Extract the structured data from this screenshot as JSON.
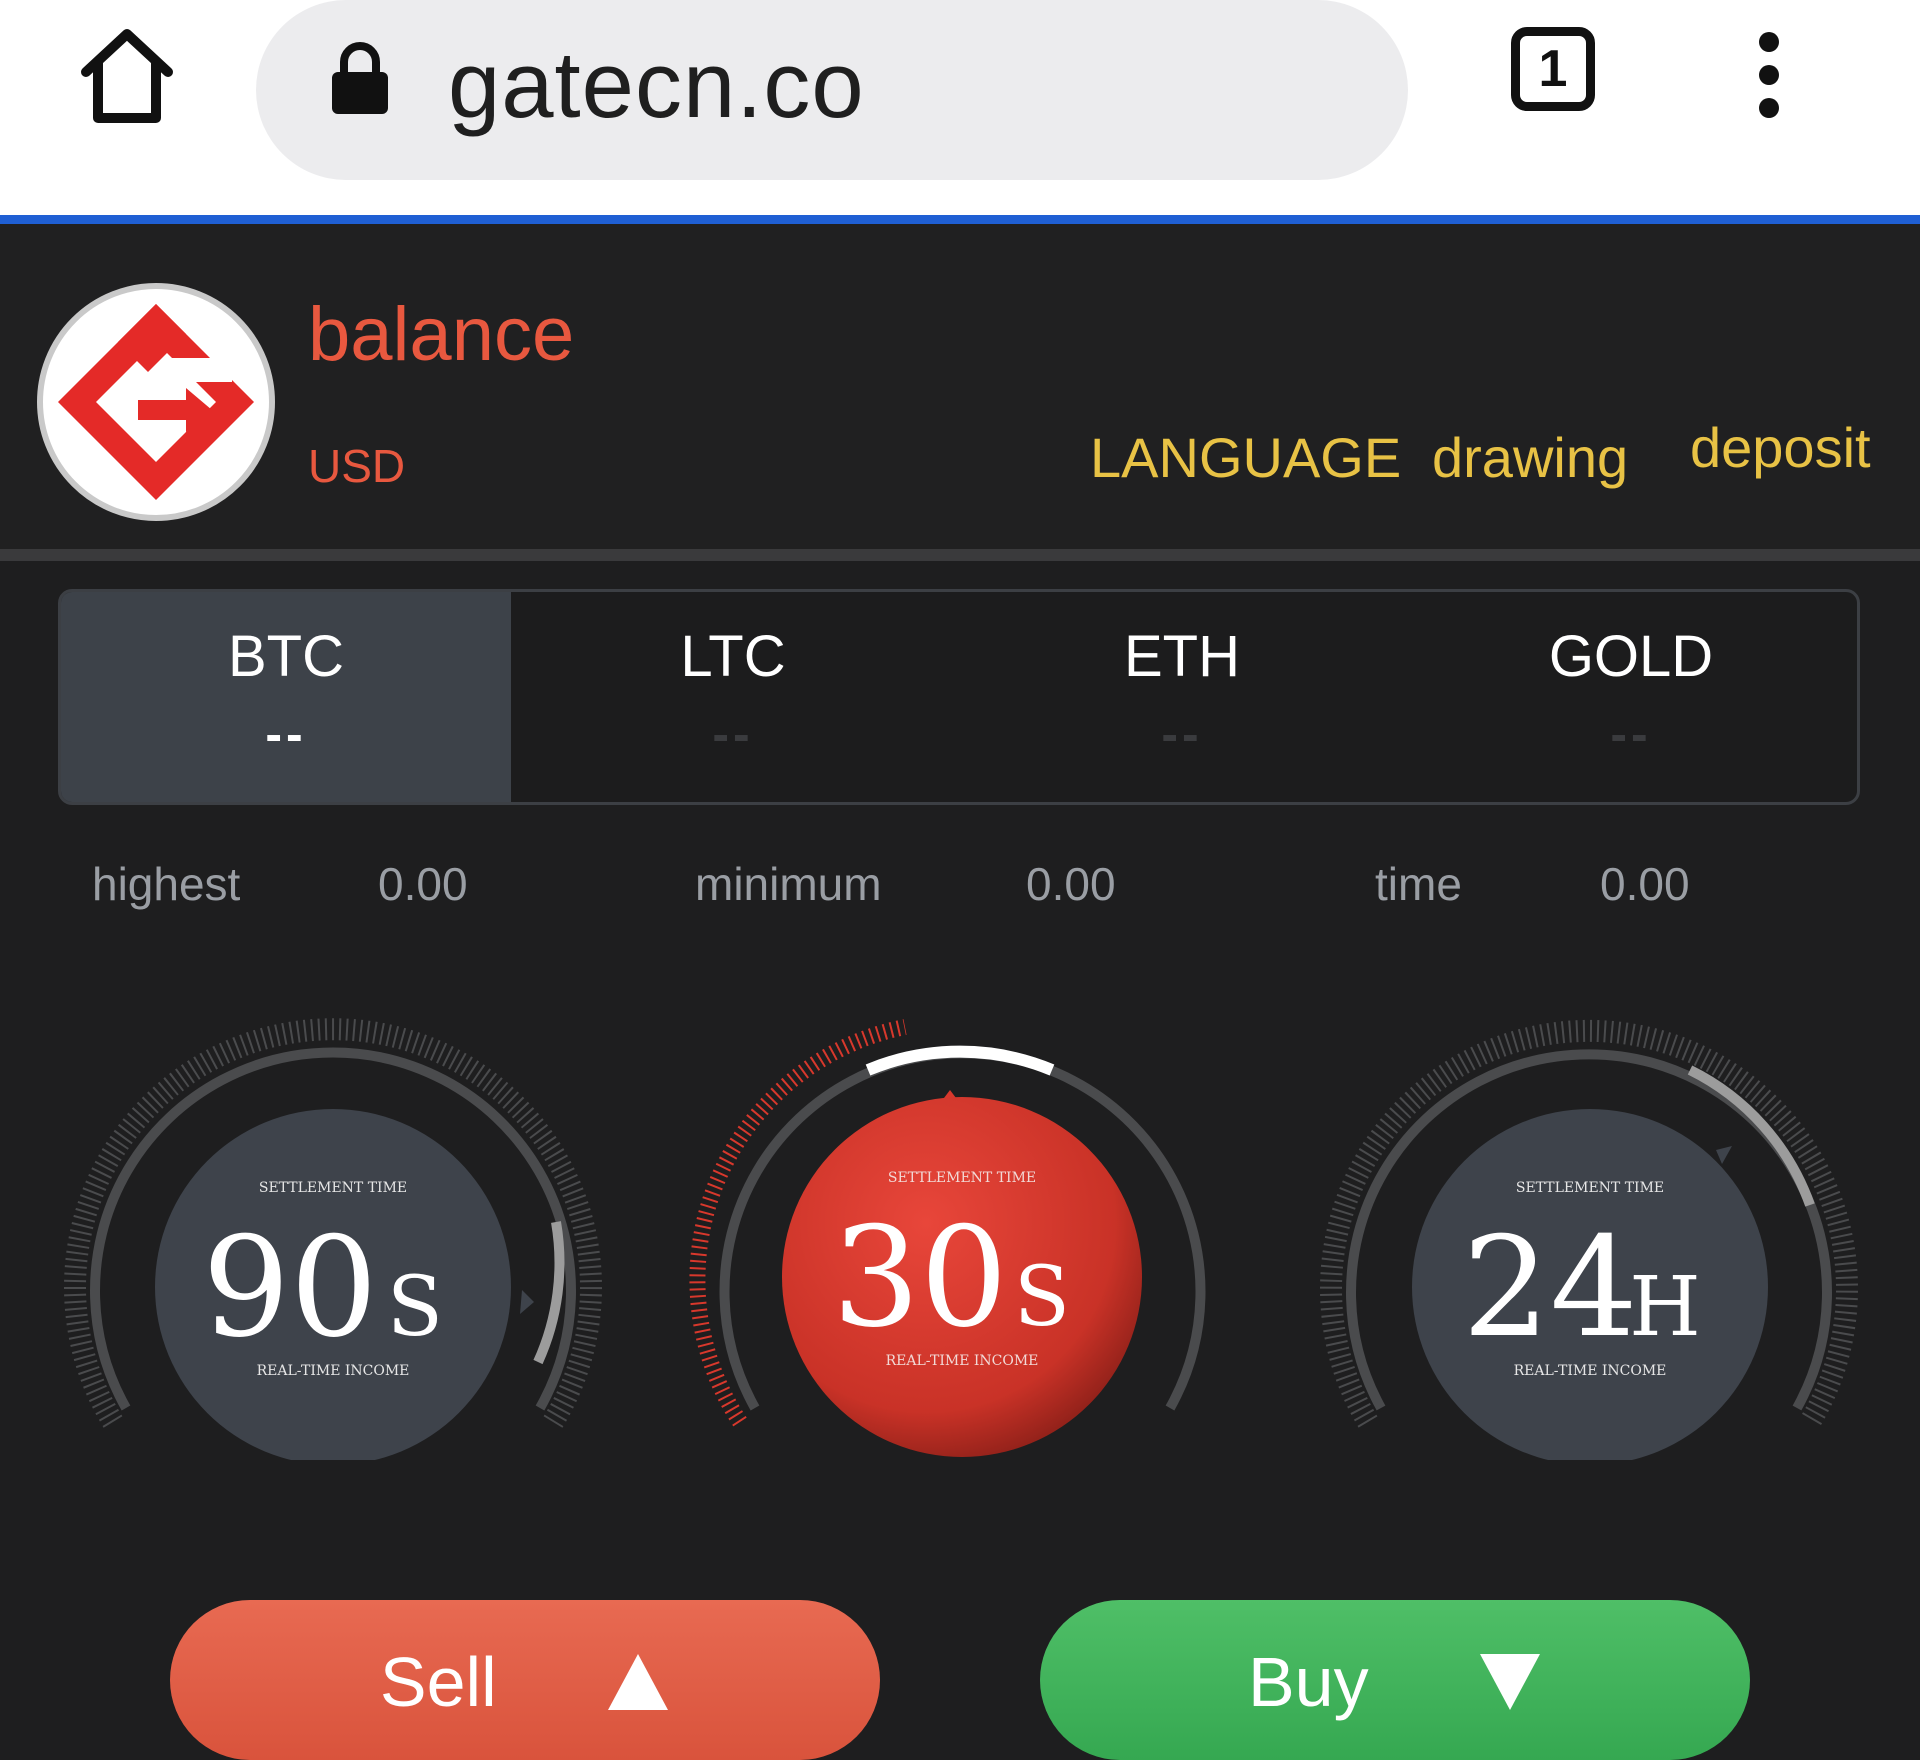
{
  "browser": {
    "url": "gatecn.co",
    "tab_count": "1",
    "icons": [
      "home-icon",
      "lock-icon",
      "tab-switcher-icon",
      "more-vert-icon"
    ]
  },
  "header": {
    "title": "balance",
    "currency": "USD",
    "nav": {
      "language": "LANGUAGE",
      "drawing": "drawing",
      "deposit": "deposit"
    },
    "colors": {
      "title": "#e8583f",
      "nav": "#e8c245"
    }
  },
  "tabs": [
    {
      "name": "BTC",
      "value": "--",
      "active": true
    },
    {
      "name": "LTC",
      "value": "--",
      "active": false
    },
    {
      "name": "ETH",
      "value": "--",
      "active": false
    },
    {
      "name": "GOLD",
      "value": "--",
      "active": false
    }
  ],
  "stats": {
    "highest_label": "highest",
    "highest_value": "0.00",
    "minimum_label": "minimum",
    "minimum_value": "0.00",
    "time_label": "time",
    "time_value": "0.00"
  },
  "dials": [
    {
      "top": "SETTLEMENT TIME",
      "value": "90",
      "unit": "S",
      "bottom": "REAL-TIME INCOME",
      "selected": false
    },
    {
      "top": "SETTLEMENT TIME",
      "value": "30",
      "unit": "S",
      "bottom": "REAL-TIME INCOME",
      "selected": true
    },
    {
      "top": "SETTLEMENT TIME",
      "value": "24",
      "unit": "H",
      "bottom": "REAL-TIME INCOME",
      "selected": false
    }
  ],
  "actions": {
    "sell": "Sell",
    "buy": "Buy",
    "colors": {
      "sell": "#e0604a",
      "buy": "#40b35c",
      "selected_dial": "#d8382c"
    }
  }
}
